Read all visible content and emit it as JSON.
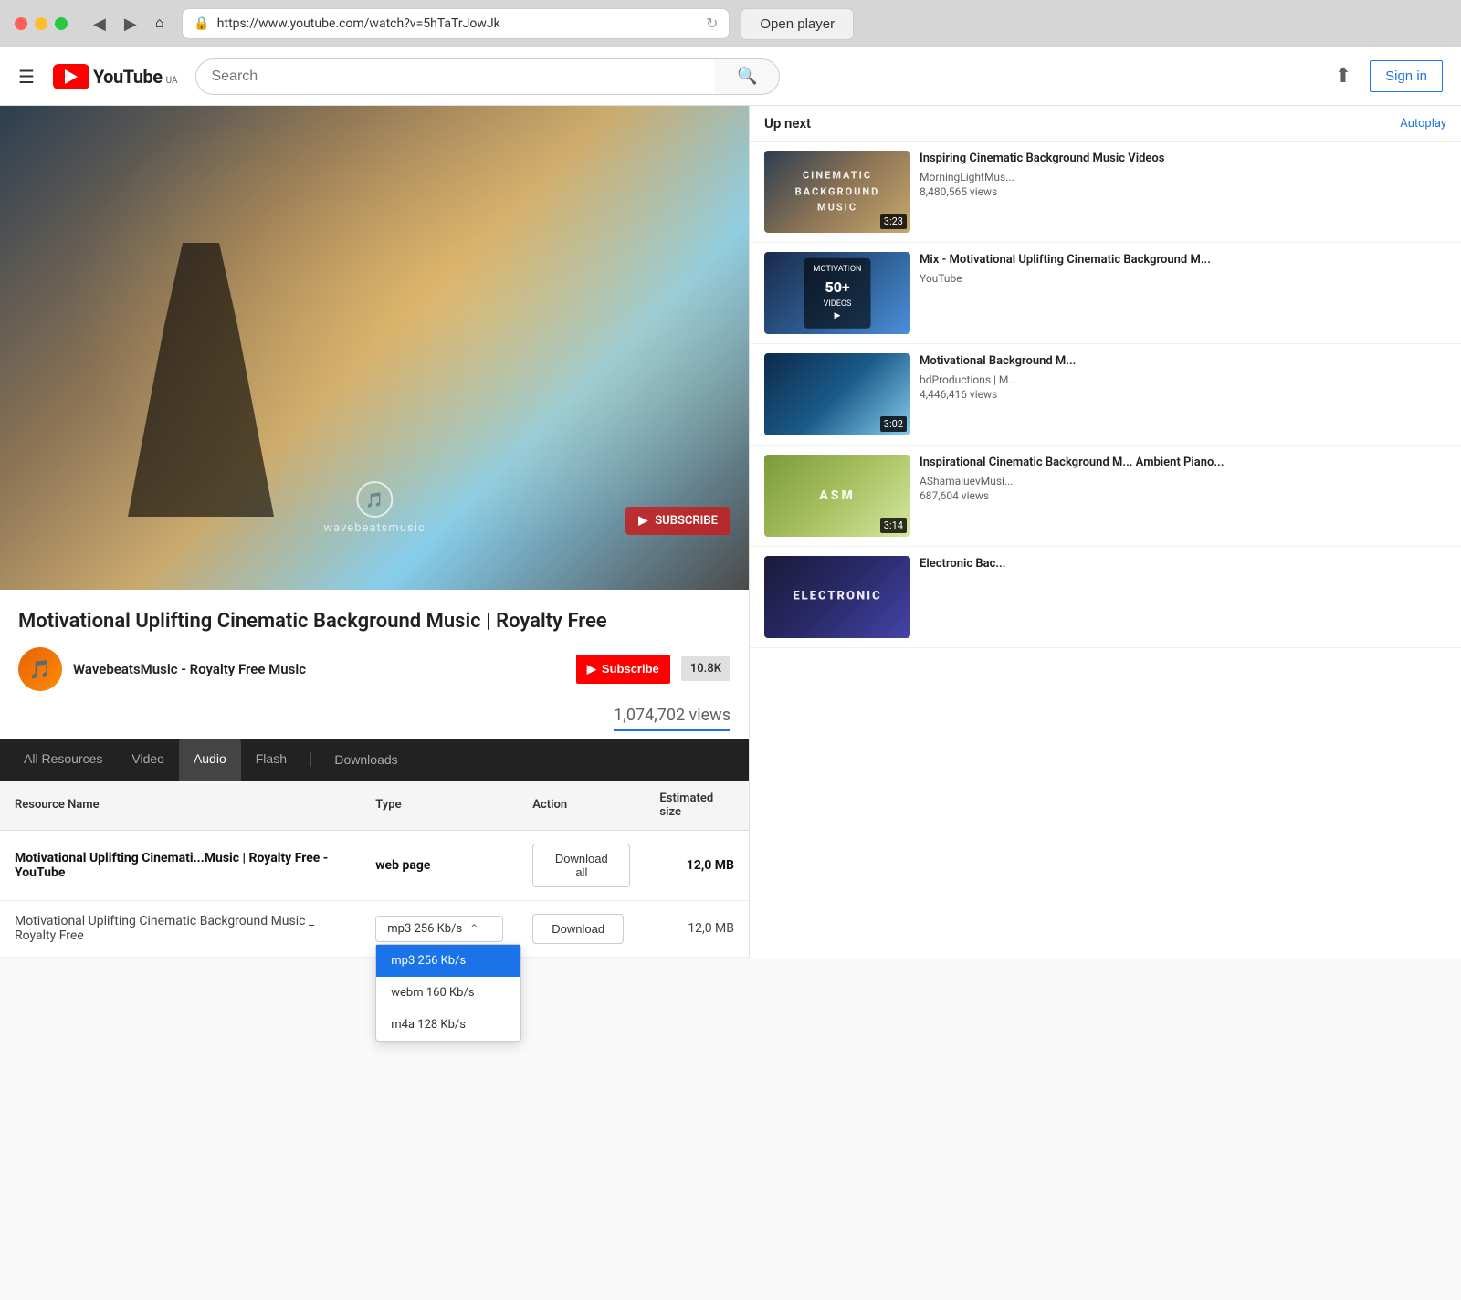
{
  "browser": {
    "address": "https://www.youtube.com/watch?v=5hTaTrJowJk",
    "open_player_label": "Open player",
    "back_icon": "◀",
    "forward_icon": "▶",
    "home_icon": "⌂",
    "reload_icon": "↻",
    "search_icon": "🔍"
  },
  "header": {
    "logo_text": "YouTube",
    "country": "UA",
    "search_placeholder": "Search",
    "upload_icon": "▲",
    "sign_in_label": "Sign in"
  },
  "video": {
    "title": "Motivational Uplifting Cinematic Background Music | Royalty Free",
    "channel_name": "WavebeatsMusic - Royalty Free Music",
    "subscribe_label": "Subscribe",
    "subscriber_count": "10.8K",
    "views": "1,074,702 views",
    "channel_icon": "🎵",
    "wavebeats_label": "wavebeatsmusic",
    "subscribe_overlay": "SUBSCRIBE"
  },
  "tabs": {
    "all_resources": "All Resources",
    "video": "Video",
    "audio": "Audio",
    "flash": "Flash",
    "downloads": "Downloads"
  },
  "table": {
    "headers": {
      "resource_name": "Resource Name",
      "type": "Type",
      "action": "Action",
      "estimated_size": "Estimated size"
    },
    "rows": [
      {
        "name": "Motivational Uplifting Cinemati...Music | Royalty Free - YouTube",
        "type": "web page",
        "action": "Download all",
        "size": "12,0 MB",
        "bold": true
      },
      {
        "name": "Motivational Uplifting Cinematic Background Music _ Royalty Free",
        "type": "mp3 256 Kb/s",
        "action": "Download",
        "size": "12,0 MB",
        "bold": false
      }
    ],
    "download_all_label": "Download all",
    "download_label": "Download"
  },
  "format_dropdown": {
    "selected": "mp3 256 Kb/s",
    "options": [
      {
        "label": "mp3 256 Kb/s",
        "selected": true
      },
      {
        "label": "webm 160 Kb/s",
        "selected": false
      },
      {
        "label": "m4a 128 Kb/s",
        "selected": false
      }
    ]
  },
  "sidebar": {
    "up_next": "Up next",
    "autoplay": "Autoplay",
    "videos": [
      {
        "title": "Inspiring Cinematic Background Music Videos",
        "channel": "MorningLightMus...",
        "views": "8,480,565 views",
        "duration": "3:23",
        "thumb_class": "thumb-1",
        "badge": "CINEMATIC\nBACKGROUND MUSIC"
      },
      {
        "title": "Mix - Motivational Uplifting Cinematic Background M...",
        "channel": "YouTube",
        "views": "",
        "duration": "50+",
        "thumb_class": "thumb-2",
        "badge": "MOTIVAT ON\n50+ VIDEOS"
      },
      {
        "title": "Motivational Background M...",
        "channel": "bdProductions | M...",
        "views": "4,446,416 views",
        "duration": "3:02",
        "thumb_class": "thumb-3",
        "badge": ""
      },
      {
        "title": "Inspirational Cinematic Background M... Ambient Piano...",
        "channel": "AShamaluevMusi...",
        "views": "687,604 views",
        "duration": "3:14",
        "thumb_class": "thumb-4",
        "badge": "ASM"
      },
      {
        "title": "Electronic Bac...",
        "channel": "",
        "views": "",
        "duration": "",
        "thumb_class": "thumb-5",
        "badge": "ELECTRONIC"
      }
    ]
  }
}
